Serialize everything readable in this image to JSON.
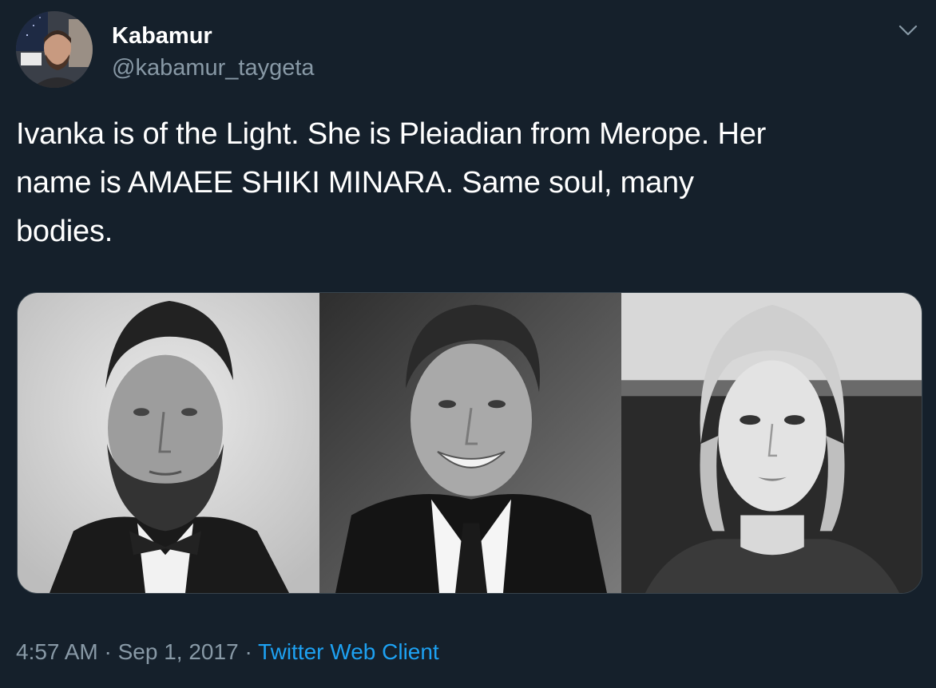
{
  "tweet": {
    "author": {
      "display_name": "Kabamur",
      "handle": "@kabamur_taygeta",
      "avatar_icon": "user-avatar"
    },
    "text_lines": [
      "Ivanka is of the Light. She is Pleiadian from Merope. Her",
      "name is AMAEE SHIKI MINARA. Same soul, many",
      "bodies."
    ],
    "media": {
      "photo_count": 3
    },
    "meta": {
      "time": "4:57 AM",
      "separator": "·",
      "date": "Sep 1, 2017",
      "source": "Twitter Web Client"
    },
    "menu_icon": "chevron-down-icon"
  },
  "colors": {
    "background": "#15202b",
    "primary_text": "#ffffff",
    "secondary_text": "#8899a6",
    "link": "#1da1f2",
    "border": "#38444d"
  }
}
